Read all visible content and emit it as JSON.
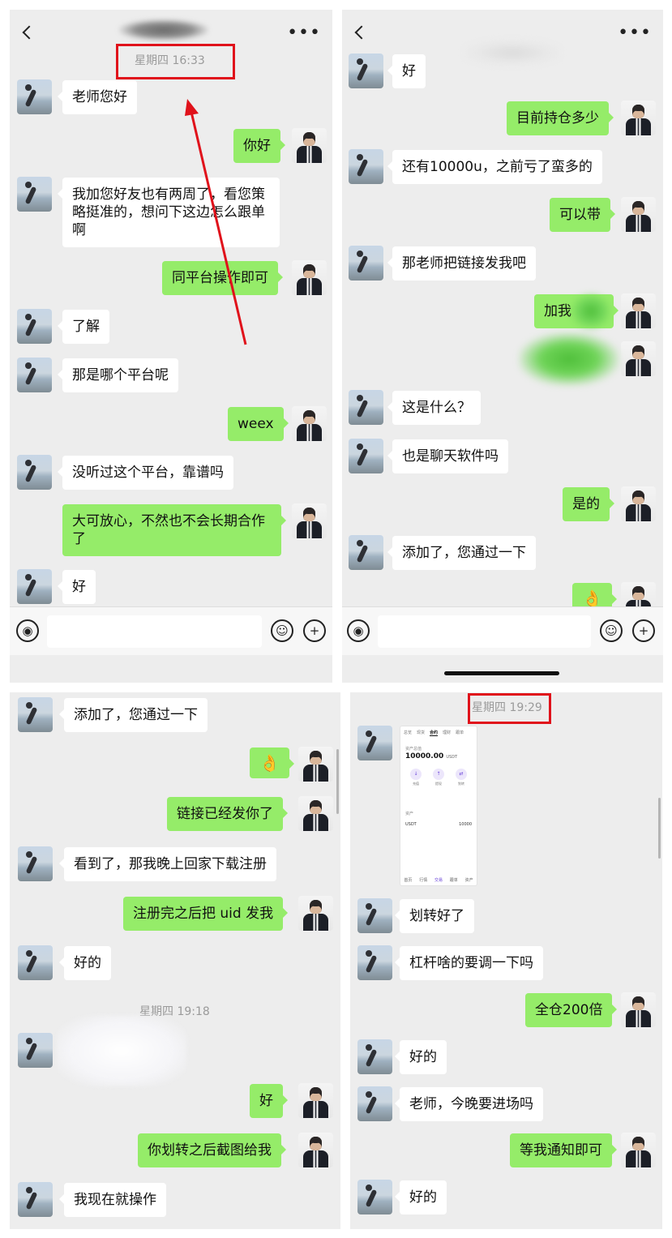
{
  "panels": {
    "p1": {
      "timestamp": "星期四 16:33",
      "messages": [
        "老师您好",
        "你好",
        "我加您好友也有两周了，看您策略挺准的，想问下这边怎么跟单啊",
        "同平台操作即可",
        "了解",
        "那是哪个平台呢",
        "weex",
        "没听过这个平台，靠谱吗",
        "大可放心，不然也不会长期合作了",
        "好"
      ]
    },
    "p2": {
      "messages": [
        "好",
        "目前持仓多少",
        "还有10000u，之前亏了蛮多的",
        "可以带",
        "那老师把链接发我吧",
        "加我",
        "这是什么？",
        "也是聊天软件吗",
        "是的",
        "添加了，您通过一下",
        "👌"
      ]
    },
    "p3": {
      "timestamp": "星期四 19:18",
      "messages": [
        "添加了，您通过一下",
        "👌",
        "链接已经发你了",
        "看到了，那我晚上回家下载注册",
        "注册完之后把 uid 发我",
        "好的",
        "好",
        "你划转之后截图给我",
        "我现在就操作"
      ]
    },
    "p4": {
      "timestamp": "星期四 19:29",
      "shared_image": {
        "tabs": [
          "总览",
          "现货",
          "合约",
          "理财",
          "跟单"
        ],
        "account_label": "资产总值",
        "balance": "10000.00",
        "balance_unit": "USDT",
        "actions": [
          "充值",
          "提现",
          "划转"
        ],
        "section_label": "资产",
        "asset_name": "USDT",
        "asset_value": "10000",
        "footer": [
          "首页",
          "行情",
          "交易",
          "跟单",
          "资产"
        ]
      },
      "messages": [
        "划转好了",
        "杠杆啥的要调一下吗",
        "全仓200倍",
        "好的",
        "老师，今晚要进场吗",
        "等我通知即可",
        "好的"
      ]
    }
  },
  "icons": {
    "back": "‹",
    "more": "•••",
    "voice": "◉",
    "emoji": "☺",
    "plus": "+"
  },
  "colors": {
    "chat_bg": "#ededed",
    "bubble_self": "#95ec69",
    "bubble_other": "#ffffff",
    "highlight": "#e0121b"
  }
}
